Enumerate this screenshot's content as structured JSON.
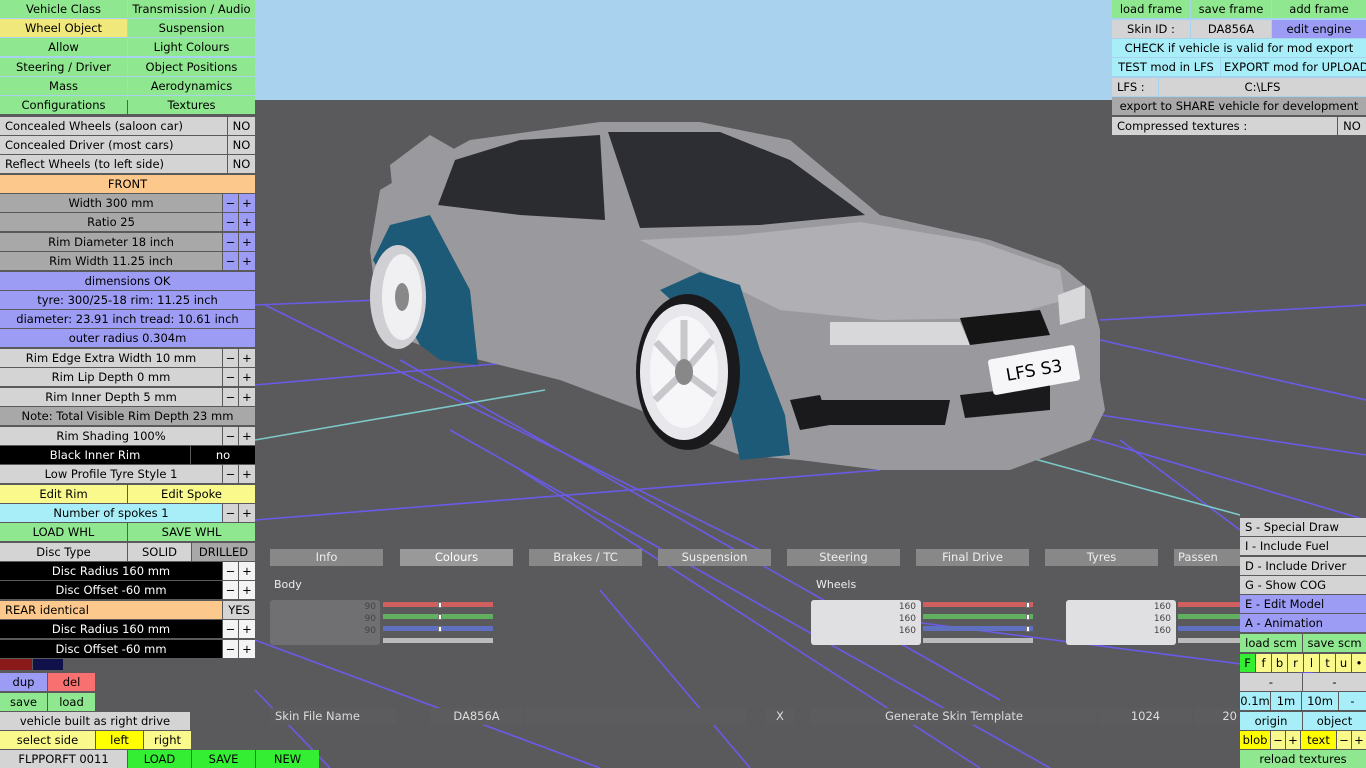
{
  "left": {
    "tabs": [
      [
        "Vehicle Class",
        "Transmission / Audio"
      ],
      [
        "Wheel Object",
        "Suspension"
      ],
      [
        "Allow",
        "Light Colours"
      ],
      [
        "Steering / Driver",
        "Object Positions"
      ],
      [
        "Mass",
        "Aerodynamics"
      ],
      [
        "Configurations",
        "Textures"
      ]
    ],
    "concealed_wheels": {
      "label": "Concealed Wheels (saloon car)",
      "value": "NO"
    },
    "concealed_driver": {
      "label": "Concealed Driver (most cars)",
      "value": "NO"
    },
    "reflect_wheels": {
      "label": "Reflect Wheels (to left side)",
      "value": "NO"
    },
    "front_header": "FRONT",
    "width": "Width 300 mm",
    "ratio": "Ratio 25",
    "rim_diameter": "Rim Diameter 18 inch",
    "rim_width": "Rim Width 11.25 inch",
    "dimensions": "dimensions OK",
    "tyre_info": "tyre: 300/25-18   rim: 11.25 inch",
    "diameter_info": "diameter: 23.91 inch   tread: 10.61 inch",
    "outer_radius": "outer radius 0.304m",
    "rim_edge": "Rim Edge Extra Width 10 mm",
    "rim_lip": "Rim Lip Depth 0 mm",
    "rim_inner": "Rim Inner Depth 5 mm",
    "note": "Note: Total Visible Rim Depth 23 mm",
    "rim_shading": "Rim Shading 100%",
    "black_inner": {
      "label": "Black Inner Rim",
      "value": "no"
    },
    "tyre_style": "Low Profile Tyre Style 1",
    "edit_rim": "Edit Rim",
    "edit_spoke": "Edit Spoke",
    "spokes": "Number of spokes 1",
    "load_whl": "LOAD WHL",
    "save_whl": "SAVE WHL",
    "disc_type": {
      "label": "Disc Type",
      "opt1": "SOLID",
      "opt2": "DRILLED"
    },
    "disc_radius": "Disc Radius 160 mm",
    "disc_offset": "Disc Offset -60 mm",
    "rear_identical": {
      "label": "REAR identical",
      "value": "YES"
    },
    "disc_radius2": "Disc Radius 160 mm",
    "disc_offset2": "Disc Offset -60 mm",
    "dup": "dup",
    "del": "del",
    "save": "save",
    "load": "load",
    "built": "vehicle built as right drive",
    "select_side": "select side",
    "left": "left",
    "right": "right",
    "code": "FLPPORFT 0011",
    "LOAD": "LOAD",
    "SAVE": "SAVE",
    "NEW": "NEW",
    "minus": "−",
    "plus": "+"
  },
  "topright": {
    "load_frame": "load frame",
    "save_frame": "save frame",
    "add_frame": "add frame",
    "skin_id_label": "Skin ID :",
    "skin_id": "DA856A",
    "edit_engine": "edit engine",
    "check": "CHECK if vehicle is valid for mod export",
    "test": "TEST mod in LFS",
    "export": "EXPORT mod for UPLOAD",
    "lfs_label": "LFS :",
    "lfs_path": "C:\\LFS",
    "share": "export to SHARE vehicle for development",
    "compressed_label": "Compressed textures :",
    "compressed_value": "NO"
  },
  "bottomright": {
    "special_draw": "S - Special Draw",
    "include_fuel": "I - Include Fuel",
    "include_driver": "D - Include Driver",
    "show_cog": "G - Show COG",
    "edit_model": "E - Edit Model",
    "animation": "A - Animation",
    "load_scm": "load scm",
    "save_scm": "save scm",
    "flags": [
      "F",
      "f",
      "b",
      "r",
      "l",
      "t",
      "u",
      "•"
    ],
    "dash1": "-",
    "dash2": "-",
    "s01": "0.1m",
    "s1": "1m",
    "s10": "10m",
    "sdash": "-",
    "origin": "origin",
    "object": "object",
    "blob": "blob",
    "text": "text",
    "reload": "reload textures"
  },
  "center": {
    "tabs": [
      "Info",
      "Colours",
      "Brakes / TC",
      "Suspension",
      "Steering",
      "Final Drive",
      "Tyres",
      "Passen"
    ],
    "body_label": "Body",
    "wheels_label": "Wheels",
    "body_values": [
      "90",
      "90",
      "90"
    ],
    "wheel_values": [
      "160",
      "160",
      "160"
    ],
    "third_values": [
      "160",
      "160",
      "160"
    ],
    "slider_levels": {
      "body": 0.52,
      "wheels": 0.95
    },
    "skin_file_label": "Skin File Name",
    "skin_file_value": "DA856A",
    "x_button": "X",
    "generate": "Generate Skin Template",
    "res1": "1024",
    "res2": "20",
    "plate": "LFS S3"
  },
  "colors": {
    "sky": "#a8d2ee",
    "floor": "#5a5a5c",
    "car_body": "#9a9a9e",
    "fender": "#1d5a78"
  }
}
